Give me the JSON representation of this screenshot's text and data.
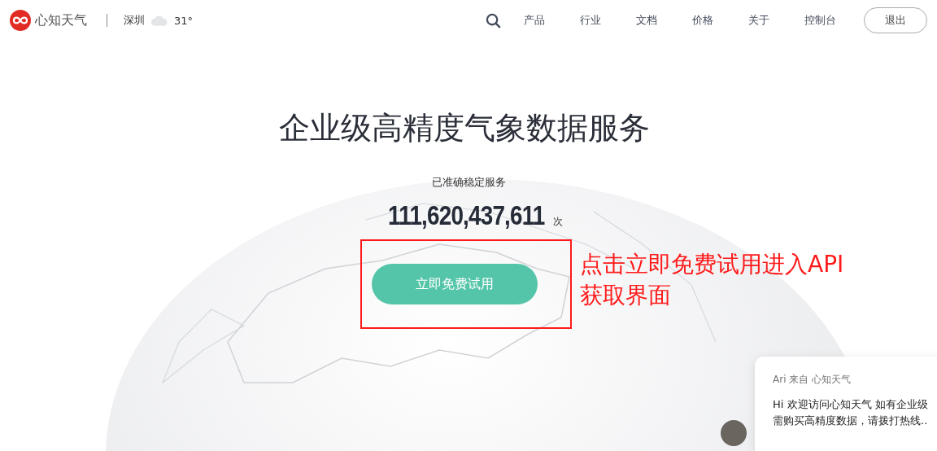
{
  "header": {
    "brand": "心知天气",
    "city": "深圳",
    "temperature": "31°",
    "nav": [
      {
        "label": "产品"
      },
      {
        "label": "行业"
      },
      {
        "label": "文档"
      },
      {
        "label": "价格"
      },
      {
        "label": "关于"
      },
      {
        "label": "控制台"
      }
    ],
    "logout": "退出"
  },
  "hero": {
    "title": "企业级高精度气象数据服务",
    "subtitle": "已准确稳定服务",
    "count": "111,620,437,611",
    "unit": "次",
    "cta": "立即免费试用"
  },
  "annotation": {
    "text": "点击立即免费试用进入API获取界面",
    "color": "#ff1a1a"
  },
  "chat": {
    "sender": "Ari 来自 心知天气",
    "lines": [
      "Hi 欢迎访问心知天气 如有企业级",
      "需购买高精度数据，请拨打热线.."
    ]
  }
}
